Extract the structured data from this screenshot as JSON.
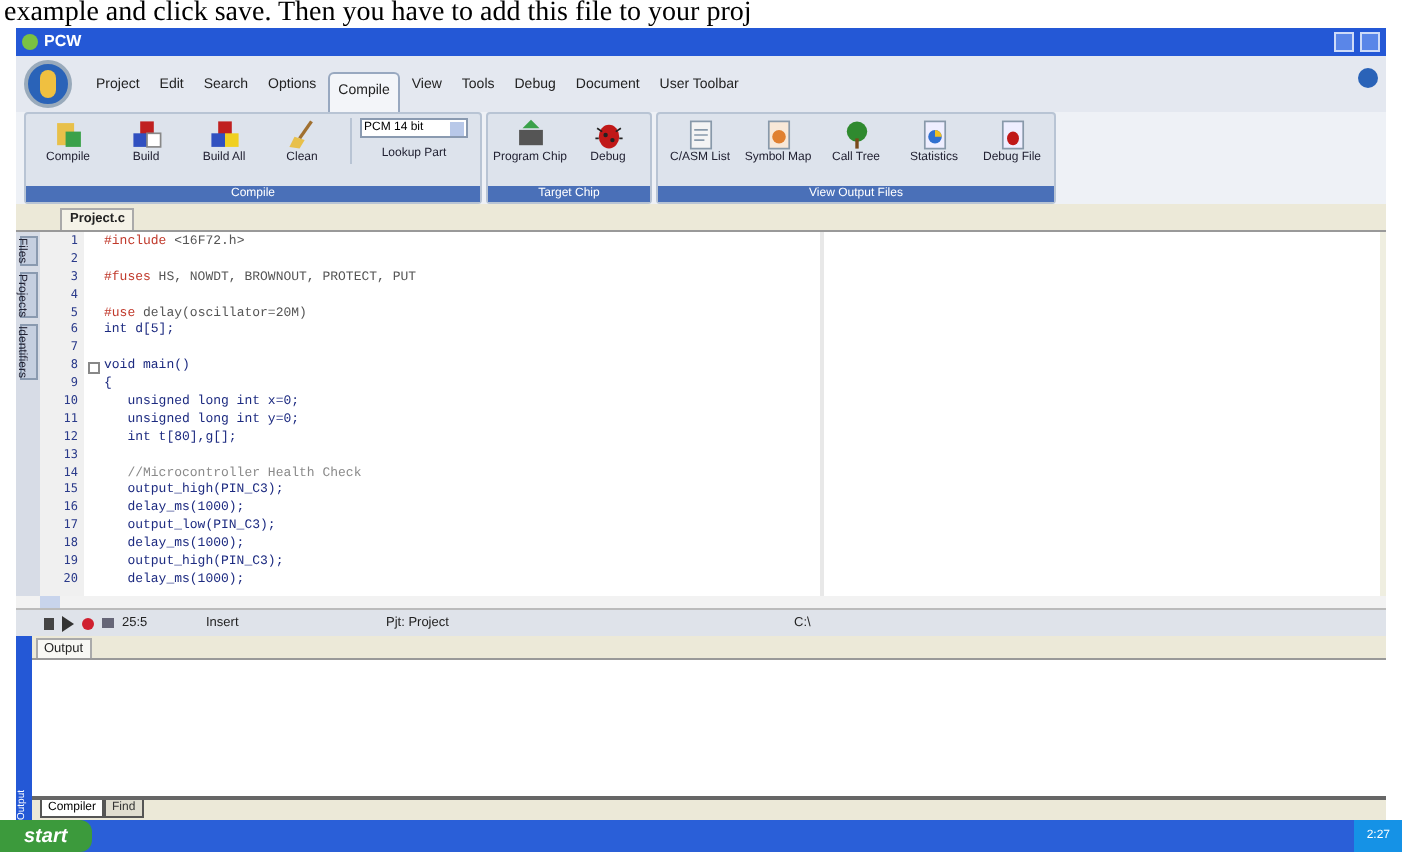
{
  "caption": "example and click save. Then you have to add this file to your proj",
  "window": {
    "title": "PCW"
  },
  "menu_tabs": [
    {
      "label": "Project",
      "selected": false
    },
    {
      "label": "Edit",
      "selected": false
    },
    {
      "label": "Search",
      "selected": false
    },
    {
      "label": "Options",
      "selected": false
    },
    {
      "label": "Compile",
      "selected": true
    },
    {
      "label": "View",
      "selected": false
    },
    {
      "label": "Tools",
      "selected": false
    },
    {
      "label": "Debug",
      "selected": false
    },
    {
      "label": "Document",
      "selected": false
    },
    {
      "label": "User Toolbar",
      "selected": false
    }
  ],
  "ribbon": [
    {
      "title": "Compile",
      "items": [
        {
          "kind": "button",
          "label": "Compile"
        },
        {
          "kind": "button",
          "label": "Build"
        },
        {
          "kind": "button",
          "label": "Build All"
        },
        {
          "kind": "button",
          "label": "Clean"
        },
        {
          "kind": "select",
          "value": "PCM 14 bit",
          "label": "Lookup Part"
        }
      ]
    },
    {
      "title": "Target Chip",
      "items": [
        {
          "kind": "button",
          "label": "Program Chip"
        },
        {
          "kind": "button",
          "label": "Debug"
        }
      ]
    },
    {
      "title": "View Output Files",
      "items": [
        {
          "kind": "button",
          "label": "C/ASM List"
        },
        {
          "kind": "button",
          "label": "Symbol Map"
        },
        {
          "kind": "button",
          "label": "Call Tree"
        },
        {
          "kind": "button",
          "label": "Statistics"
        },
        {
          "kind": "button",
          "label": "Debug File"
        }
      ]
    }
  ],
  "doc_tab": "Project.c",
  "side_tabs": [
    "Files",
    "Projects",
    "Identifiers"
  ],
  "code": [
    {
      "n": "1",
      "kind": "directive",
      "text": "#include <16F72.h>"
    },
    {
      "n": "2"
    },
    {
      "n": "3",
      "kind": "directive",
      "text": "#fuses HS, NOWDT, BROWNOUT, PROTECT, PUT"
    },
    {
      "n": "4"
    },
    {
      "n": "5",
      "kind": "directive",
      "text": "#use delay(oscillator=20M)"
    },
    {
      "n": "6",
      "kind": "code",
      "text": "int d[5];"
    },
    {
      "n": "7"
    },
    {
      "n": "8",
      "kind": "code",
      "text": "void main()",
      "fold": true
    },
    {
      "n": "9",
      "kind": "code",
      "text": "{"
    },
    {
      "n": "10",
      "kind": "code",
      "text": "   unsigned long int x=0;"
    },
    {
      "n": "11",
      "kind": "code",
      "text": "   unsigned long int y=0;"
    },
    {
      "n": "12",
      "kind": "code",
      "text": "   int t[80],g[];"
    },
    {
      "n": "13"
    },
    {
      "n": "14",
      "kind": "comment",
      "text": "   //Microcontroller Health Check"
    },
    {
      "n": "15",
      "kind": "code",
      "text": "   output_high(PIN_C3);"
    },
    {
      "n": "16",
      "kind": "code",
      "text": "   delay_ms(1000);"
    },
    {
      "n": "17",
      "kind": "code",
      "text": "   output_low(PIN_C3);"
    },
    {
      "n": "18",
      "kind": "code",
      "text": "   delay_ms(1000);"
    },
    {
      "n": "19",
      "kind": "code",
      "text": "   output_high(PIN_C3);"
    },
    {
      "n": "20",
      "kind": "code",
      "text": "   delay_ms(1000);"
    }
  ],
  "status_bar": {
    "position": "25:5",
    "mode": "Insert",
    "project": "Pjt: Project",
    "path": "C:\\"
  },
  "output": {
    "side_label": "Output",
    "tab": "Output",
    "bottom_tabs": [
      {
        "label": "Compiler",
        "selected": true
      },
      {
        "label": "Find",
        "selected": false
      }
    ]
  },
  "taskbar": {
    "start": "start",
    "clock": "2:27"
  }
}
